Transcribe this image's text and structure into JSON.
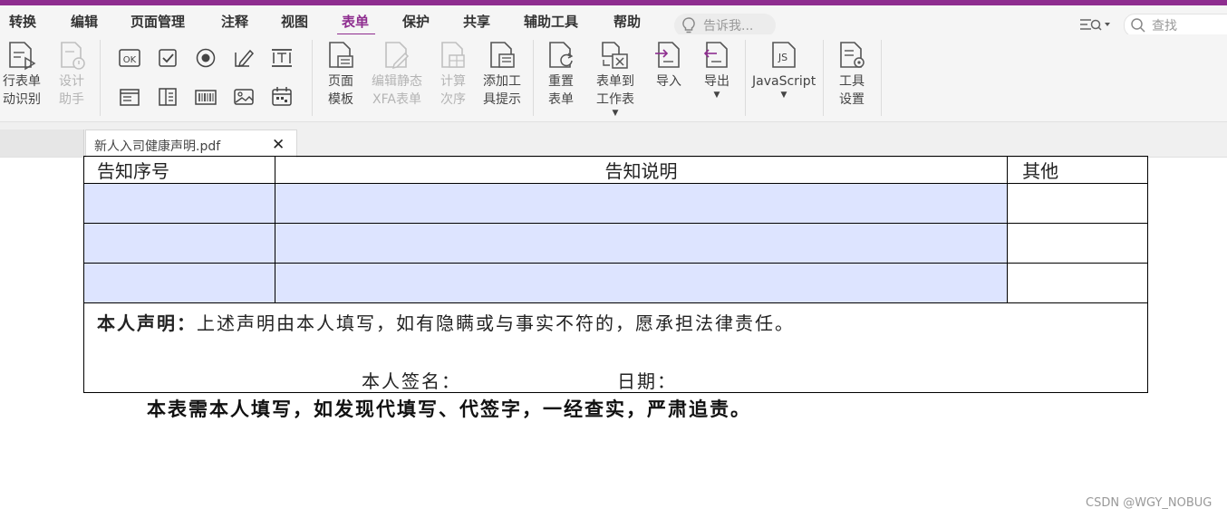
{
  "colors": {
    "accent": "#8e2d8f",
    "field": "#dde4ff"
  },
  "menu": {
    "items": [
      "转换",
      "编辑",
      "页面管理",
      "注释",
      "视图",
      "表单",
      "保护",
      "共享",
      "辅助工具",
      "帮助"
    ],
    "active": "表单",
    "tell_me": "告诉我...",
    "search": "查找"
  },
  "ribbon": {
    "run_form_recognition": "行表单\n动识别",
    "design_assistant": "设计\n助手",
    "page_template": "页面\n模板",
    "edit_static_xfa": "编辑静态\nXFA表单",
    "calc_order": "计算\n次序",
    "add_tooltip": "添加工\n具提示",
    "reset_form": "重置\n表单",
    "form_to_sheet": "表单到\n工作表",
    "import": "导入",
    "export": "导出",
    "javascript": "JavaScript",
    "tool_settings": "工具\n设置",
    "small_tools": [
      "ok-button-tool",
      "checkbox-tool",
      "radio-button-tool",
      "text-field-tool",
      "list-box-tool",
      "combo-box-tool",
      "signature-field-tool",
      "barcode-tool",
      "image-field-tool",
      "date-field-tool"
    ]
  },
  "tabs": {
    "document": "新人入司健康声明.pdf",
    "close": "✕"
  },
  "document": {
    "headers": [
      "告知序号",
      "告知说明",
      "其他"
    ],
    "row_count": 3,
    "statement_label": "本人声明：",
    "statement_text": "上述声明由本人填写，如有隐瞒或与事实不符的，愿承担法律责任。",
    "signature_label": "本人签名：",
    "date_label": "日期：",
    "note": "本表需本人填写，如发现代填写、代签字，一经查实，严肃追责。"
  },
  "watermark": "CSDN @WGY_NOBUG"
}
